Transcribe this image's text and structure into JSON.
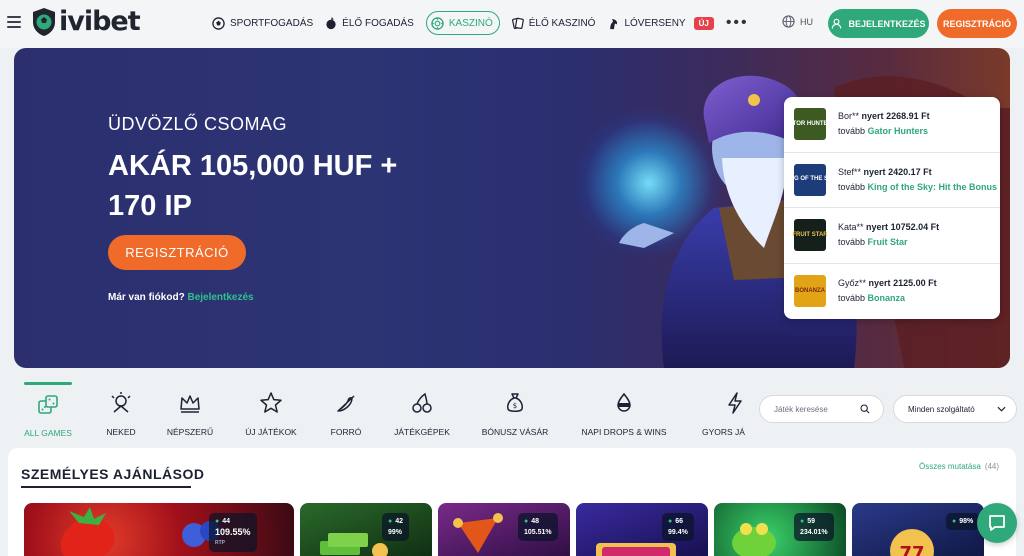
{
  "header": {
    "logo_text": "ivibet",
    "nav": [
      {
        "label": "SPORTFOGADÁS",
        "icon": "soccer-ball-icon"
      },
      {
        "label": "ÉLŐ FOGADÁS",
        "icon": "live-ball-icon"
      },
      {
        "label": "KASZINÓ",
        "icon": "casino-chip-icon",
        "active": true
      },
      {
        "label": "ÉLŐ KASZINÓ",
        "icon": "cards-icon"
      },
      {
        "label": "LÓVERSENY",
        "icon": "horse-icon",
        "badge": "ÚJ"
      }
    ],
    "more": "•••",
    "lang": "HU",
    "login_label": "BEJELENTKEZÉS",
    "register_label": "REGISZTRÁCIÓ"
  },
  "hero": {
    "subtitle": "ÜDVÖZLŐ CSOMAG",
    "title_line1": "AKÁR 105,000 HUF +",
    "title_line2": "170 IP",
    "cta": "REGISZTRÁCIÓ",
    "login_prompt": "Már van fiókod?",
    "login_link": "Bejelentkezés"
  },
  "winners": [
    {
      "name": "Bor**",
      "won": "nyert",
      "amount": "2268.91 Ft",
      "tovabb": "tovább",
      "game": "Gator Hunters",
      "thumb_text": "GATOR HUNTERS",
      "color": "#3c5a22"
    },
    {
      "name": "Stef**",
      "won": "nyert",
      "amount": "2420.17 Ft",
      "tovabb": "tovább",
      "game": "King of the Sky: Hit the Bonus",
      "thumb_text": "KING OF THE SKY",
      "color": "#1d3d7a"
    },
    {
      "name": "Kata**",
      "won": "nyert",
      "amount": "10752.04 Ft",
      "tovabb": "tovább",
      "game": "Fruit Star",
      "thumb_text": "FRUIT STAR",
      "color": "#15201a"
    },
    {
      "name": "Győz**",
      "won": "nyert",
      "amount": "2125.00 Ft",
      "tovabb": "tovább",
      "game": "Bonanza",
      "thumb_text": "BONANZA",
      "color": "#e3a317"
    }
  ],
  "categories": [
    {
      "label": "ALL GAMES",
      "icon": "dice-icon",
      "active": true
    },
    {
      "label": "NEKED",
      "icon": "gift-sparkle-icon"
    },
    {
      "label": "NÉPSZERŰ",
      "icon": "crown-icon"
    },
    {
      "label": "ÚJ JÁTÉKOK",
      "icon": "star-icon"
    },
    {
      "label": "FORRÓ",
      "icon": "chili-icon"
    },
    {
      "label": "JÁTÉKGÉPEK",
      "icon": "cherries-icon"
    },
    {
      "label": "BÓNUSZ VÁSÁR",
      "icon": "money-bag-icon"
    },
    {
      "label": "NAPI DROPS & WINS",
      "icon": "drops-wins-icon"
    },
    {
      "label": "GYORS JÁ",
      "icon": "lightning-icon"
    }
  ],
  "search": {
    "placeholder": "Játék keresése"
  },
  "provider": {
    "value": "Minden szolgáltató"
  },
  "section": {
    "title": "SZEMÉLYES AJÁNLÁSOD",
    "all_label": "Összes mutatása",
    "all_count": "(44)"
  },
  "tiles": [
    {
      "players": "44",
      "rtp": "109.55%",
      "rtp_label": "RTP",
      "color": "#b0121a"
    },
    {
      "players": "42",
      "rtp": "99%",
      "color": "#1f4d1f"
    },
    {
      "players": "48",
      "rtp": "105.51%",
      "color": "#4a1768"
    },
    {
      "players": "66",
      "rtp": "99.4%",
      "color": "#3a1e8a"
    },
    {
      "players": "59",
      "rtp": "234.01%",
      "color": "#0f6b3a"
    },
    {
      "players": "",
      "rtp": "98%",
      "color": "#1e2e66"
    }
  ]
}
